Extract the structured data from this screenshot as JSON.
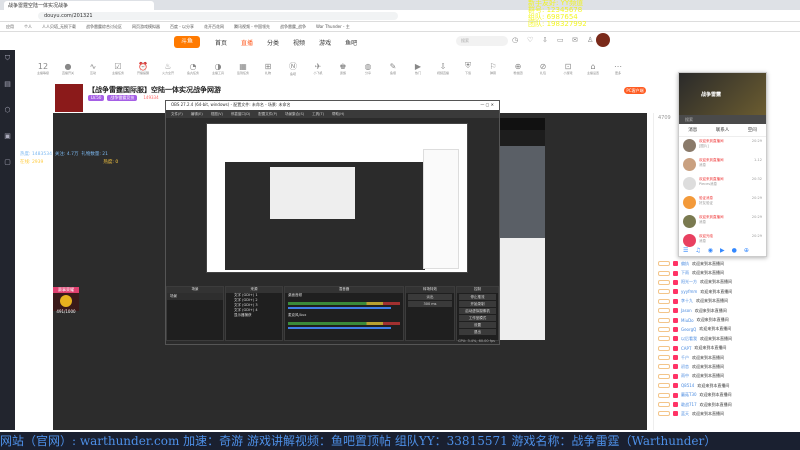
{
  "browser": {
    "tab_title": "战争雷霆空陆一体实况战争",
    "url": "douyu.com/201321",
    "bookmarks": [
      "应用",
      "个人",
      "人人贝塔_无损下载",
      "战争雷霆综合讨论区",
      "网页游戏模拟器",
      "百度 - 以分享",
      "花开百花网",
      "腾讯视频 - 中国领先",
      "战争雷霆_战争",
      "War Thunder - 主"
    ]
  },
  "overlay": [
    "新手友好: YY频道",
    "群号: 12345678",
    "组队: 6987654",
    "团队: 198327992"
  ],
  "header": {
    "logo": "斗鱼",
    "nav": [
      "首页",
      "直播",
      "分类",
      "视频",
      "游戏",
      "鱼吧"
    ],
    "search_placeholder": "搜索"
  },
  "toolbar": {
    "count": "12",
    "items": [
      "主播等级",
      "直播开关",
      "互动",
      "主播任务",
      "开播提醒",
      "火力全开",
      "鱼丸任务",
      "主播工具",
      "签到任务",
      "礼物",
      "鱼吧",
      "小飞机",
      "贵族",
      "分享",
      "鱼塘",
      "热门",
      "视频直播",
      "下载",
      "弹幕",
      "粉丝团",
      "礼包",
      "小游戏",
      "主播设置",
      "更多"
    ],
    "pc_button": "PC客户端"
  },
  "room": {
    "title": "【战争雷霆国际服】空陆一体实况战争网游",
    "tags": [
      "LV.50",
      "战争雷霆竞技",
      "149334"
    ],
    "hot": "4709"
  },
  "stats": {
    "hot": "热度: 1483534",
    "fans": "关注: 4.7万",
    "gifts": "礼物数量: 21",
    "online": "在线: 2939",
    "heat": "热度: 0"
  },
  "badge": {
    "label": "赛事荣耀",
    "progress": "491/1000"
  },
  "obs": {
    "title": "OBS 27.2.4 (64-bit, windows) - 配置文件: 未命名 - 场景: 未命名",
    "menu": [
      "文件(F)",
      "编辑(E)",
      "视图(V)",
      "停靠窗口(D)",
      "配置文件(P)",
      "场景集合(S)",
      "工具(T)",
      "帮助(H)"
    ],
    "docks": [
      "场景",
      "来源",
      "混音器",
      "转场特效",
      "控制"
    ],
    "scene": "场景",
    "sources": [
      "文字 (GDI+) 1",
      "文字 (GDI+) 2",
      "文字 (GDI+) 3",
      "文字 (GDI+) 4",
      "显示器捕获"
    ],
    "mixer": [
      "桌面音频",
      "麦克风/Aux"
    ],
    "transition": "淡出",
    "duration": "300 ms",
    "controls": [
      "停止推流",
      "开始录制",
      "启动虚拟摄像机",
      "工作室模式",
      "设置",
      "退出"
    ],
    "status": "CPU: 3.4%, 60.00 fps"
  },
  "qq": {
    "name": "战争雷霆",
    "search": "搜索",
    "tabs": [
      "消息",
      "联系人",
      "空间"
    ],
    "items": [
      {
        "name": "欢迎来到直播间",
        "msg": "[图片]",
        "time": "20:29"
      },
      {
        "name": "欢迎来到直播间",
        "msg": "消息",
        "time": "1-12"
      },
      {
        "name": "欢迎来到直播间",
        "msg": "Pieces消息",
        "time": "20:32"
      },
      {
        "name": "验证消息",
        "msg": "好友验证",
        "time": "20:29"
      },
      {
        "name": "欢迎来到直播间",
        "msg": "消息",
        "time": "20:29"
      },
      {
        "name": "欢迎光临",
        "msg": "消息",
        "time": "20:29"
      }
    ]
  },
  "chat": {
    "welcome": "欢迎来到本直播间",
    "users": [
      "偏执",
      "下雨",
      "阳光一方",
      "yyyfmm",
      "李十九",
      "Jason",
      "MiuDo",
      "GeorgQ",
      "以后看我",
      "CAPT",
      "千户",
      "初恋",
      "雨中",
      "Q8514",
      "蘑菇T30",
      "敢战717",
      "蓝天"
    ]
  },
  "ticker": "网站（官网）: warthunder.com  加速：奇游  游戏讲解视频：鱼吧置顶帖  组队YY：33815571  游戏名称：战争雷霆（Warthunder）"
}
